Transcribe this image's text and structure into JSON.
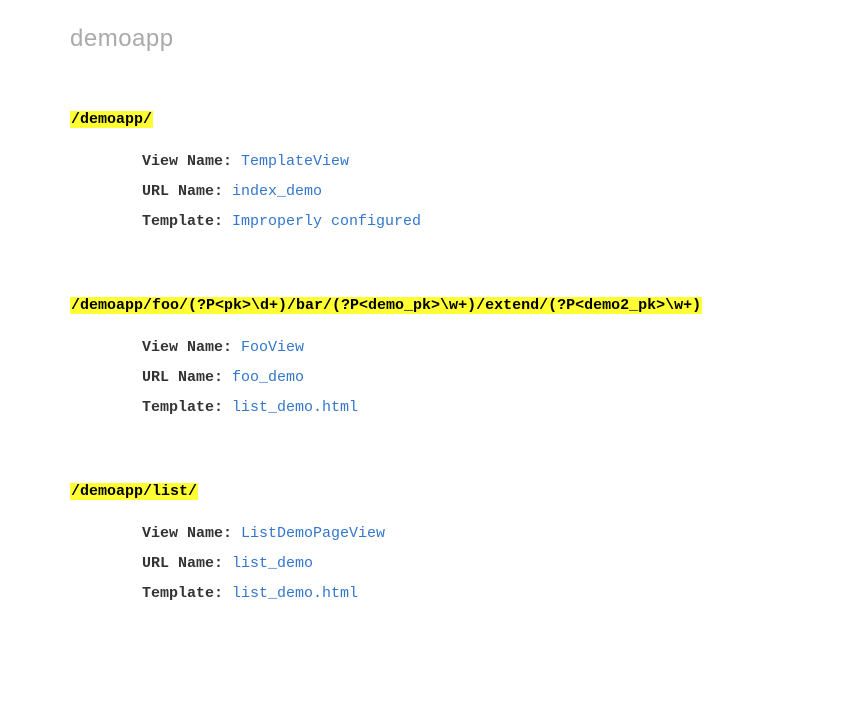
{
  "page_title": "demoapp",
  "labels": {
    "view_name": "View Name:",
    "url_name": "URL Name:",
    "template": "Template:"
  },
  "routes": [
    {
      "path": "/demoapp/",
      "view_name": "TemplateView",
      "url_name": "index_demo",
      "template": "Improperly configured"
    },
    {
      "path": "/demoapp/foo/(?P<pk>\\d+)/bar/(?P<demo_pk>\\w+)/extend/(?P<demo2_pk>\\w+)",
      "view_name": "FooView",
      "url_name": "foo_demo",
      "template": "list_demo.html"
    },
    {
      "path": "/demoapp/list/",
      "view_name": "ListDemoPageView",
      "url_name": "list_demo",
      "template": "list_demo.html"
    }
  ]
}
